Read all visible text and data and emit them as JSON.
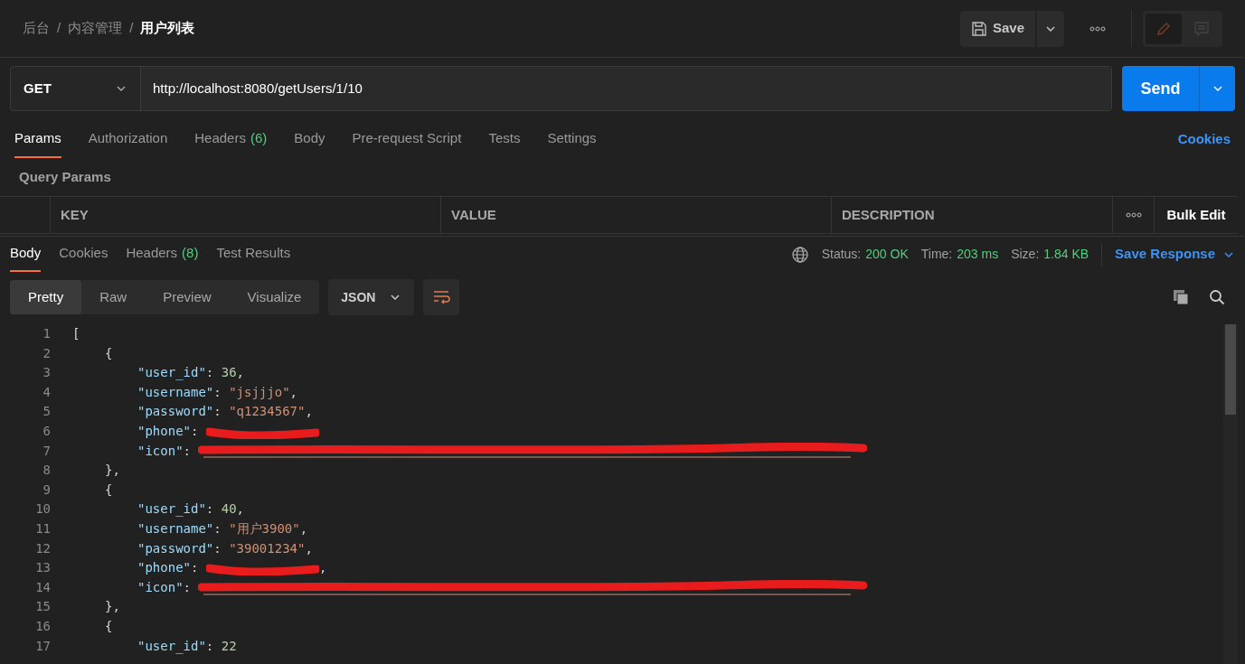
{
  "breadcrumb": [
    {
      "label": "后台",
      "current": false
    },
    {
      "label": "内容管理",
      "current": false
    },
    {
      "label": "用户列表",
      "current": true
    }
  ],
  "breadcrumb_separator": "/",
  "toolbar": {
    "save": "Save"
  },
  "mode_switch": [
    {
      "kind": "edit",
      "selected": true
    },
    {
      "kind": "comment",
      "selected": false
    }
  ],
  "request": {
    "method": "GET",
    "url": "http://localhost:8080/getUsers/1/10",
    "send": "Send"
  },
  "request_tabs": [
    {
      "label": "Params",
      "selected": true
    },
    {
      "label": "Authorization",
      "selected": false
    },
    {
      "label": "Headers",
      "count": "(6)",
      "selected": false
    },
    {
      "label": "Body",
      "selected": false
    },
    {
      "label": "Pre-request Script",
      "selected": false
    },
    {
      "label": "Tests",
      "selected": false
    },
    {
      "label": "Settings",
      "selected": false
    }
  ],
  "cookies_link": "Cookies",
  "query_params": {
    "title": "Query Params",
    "columns": [
      "KEY",
      "VALUE",
      "DESCRIPTION"
    ],
    "bulk_edit": "Bulk Edit"
  },
  "response_tabs": [
    {
      "label": "Body",
      "selected": true
    },
    {
      "label": "Cookies",
      "selected": false
    },
    {
      "label": "Headers",
      "count": "(8)",
      "selected": false
    },
    {
      "label": "Test Results",
      "selected": false
    }
  ],
  "status": [
    {
      "label": "Status:",
      "value": "200 OK"
    },
    {
      "label": "Time:",
      "value": "203 ms"
    },
    {
      "label": "Size:",
      "value": "1.84 KB"
    }
  ],
  "save_response": "Save Response",
  "view_modes": [
    {
      "label": "Pretty",
      "selected": true
    },
    {
      "label": "Raw",
      "selected": false
    },
    {
      "label": "Preview",
      "selected": false
    },
    {
      "label": "Visualize",
      "selected": false
    }
  ],
  "format": "JSON",
  "code_lines": [
    {
      "number": "1",
      "tokens": [
        {
          "kind": "punct",
          "text": "["
        }
      ],
      "children": [
        {
          "number": "2",
          "tokens": [
            {
              "kind": "punct",
              "text": "{"
            }
          ],
          "children": [
            {
              "number": "3",
              "tokens": [
                {
                  "kind": "key",
                  "text": "\"user_id\""
                },
                {
                  "kind": "punct",
                  "text": ": "
                },
                {
                  "kind": "num",
                  "text": "36"
                },
                {
                  "kind": "punct",
                  "text": ","
                }
              ]
            },
            {
              "number": "4",
              "tokens": [
                {
                  "kind": "key",
                  "text": "\"username\""
                },
                {
                  "kind": "punct",
                  "text": ": "
                },
                {
                  "kind": "str",
                  "text": "\"jsjjjo\""
                },
                {
                  "kind": "punct",
                  "text": ","
                }
              ]
            },
            {
              "number": "5",
              "tokens": [
                {
                  "kind": "key",
                  "text": "\"password\""
                },
                {
                  "kind": "punct",
                  "text": ": "
                },
                {
                  "kind": "str",
                  "text": "\"q1234567\""
                },
                {
                  "kind": "punct",
                  "text": ","
                }
              ]
            },
            {
              "number": "6",
              "tokens": [
                {
                  "kind": "key",
                  "text": "\"phone\""
                },
                {
                  "kind": "punct",
                  "text": ": "
                },
                {
                  "kind": "redacted_short"
                }
              ]
            },
            {
              "number": "7",
              "tokens": [
                {
                  "kind": "key",
                  "text": "\"icon\""
                },
                {
                  "kind": "punct",
                  "text": ": "
                },
                {
                  "kind": "redacted_link"
                }
              ]
            }
          ]
        },
        {
          "number": "8",
          "tokens": [
            {
              "kind": "punct",
              "text": "},"
            }
          ]
        },
        {
          "number": "9",
          "tokens": [
            {
              "kind": "punct",
              "text": "{"
            }
          ],
          "children": [
            {
              "number": "10",
              "tokens": [
                {
                  "kind": "key",
                  "text": "\"user_id\""
                },
                {
                  "kind": "punct",
                  "text": ": "
                },
                {
                  "kind": "num",
                  "text": "40"
                },
                {
                  "kind": "punct",
                  "text": ","
                }
              ]
            },
            {
              "number": "11",
              "tokens": [
                {
                  "kind": "key",
                  "text": "\"username\""
                },
                {
                  "kind": "punct",
                  "text": ": "
                },
                {
                  "kind": "str",
                  "text": "\"用户3900\""
                },
                {
                  "kind": "punct",
                  "text": ","
                }
              ]
            },
            {
              "number": "12",
              "tokens": [
                {
                  "kind": "key",
                  "text": "\"password\""
                },
                {
                  "kind": "punct",
                  "text": ": "
                },
                {
                  "kind": "str",
                  "text": "\"39001234\""
                },
                {
                  "kind": "punct",
                  "text": ","
                }
              ]
            },
            {
              "number": "13",
              "tokens": [
                {
                  "kind": "key",
                  "text": "\"phone\""
                },
                {
                  "kind": "punct",
                  "text": ": "
                },
                {
                  "kind": "redacted_short"
                },
                {
                  "kind": "punct",
                  "text": ","
                }
              ]
            },
            {
              "number": "14",
              "tokens": [
                {
                  "kind": "key",
                  "text": "\"icon\""
                },
                {
                  "kind": "punct",
                  "text": ": "
                },
                {
                  "kind": "redacted_link"
                }
              ]
            }
          ]
        },
        {
          "number": "15",
          "tokens": [
            {
              "kind": "punct",
              "text": "},"
            }
          ]
        },
        {
          "number": "16",
          "tokens": [
            {
              "kind": "punct",
              "text": "{"
            }
          ],
          "children": [
            {
              "number": "17",
              "tokens": [
                {
                  "kind": "key",
                  "text": "\"user_id\""
                },
                {
                  "kind": "punct",
                  "text": ": "
                },
                {
                  "kind": "num",
                  "text": "22"
                }
              ]
            }
          ]
        }
      ]
    }
  ]
}
